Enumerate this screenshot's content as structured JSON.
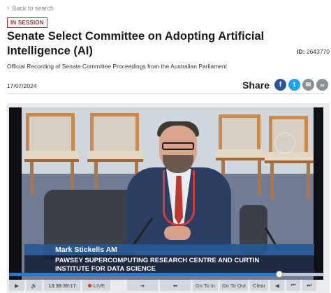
{
  "nav": {
    "back_label": "Back to search"
  },
  "status_badge": "IN SESSION",
  "title": "Senate Select Committee on Adopting Artificial Intelligence (AI)",
  "doc_id": {
    "label": "ID:",
    "value": "2643770"
  },
  "subtitle": "Official Recording of Senate Committee Proceedings from the Australian Parliament",
  "date": "17/07/2024",
  "share": {
    "label": "Share",
    "buttons": [
      {
        "icon": "facebook-icon",
        "glyph": "f",
        "color": "#2f5597"
      },
      {
        "icon": "twitter-icon",
        "glyph": "t",
        "color": "#1da1f2"
      },
      {
        "icon": "email-icon",
        "glyph": "✉",
        "color": "#8a8f95"
      },
      {
        "icon": "link-icon",
        "glyph": "∞",
        "color": "#8a8f95"
      }
    ]
  },
  "video": {
    "speaker_name": "Mark Stickells AM",
    "speaker_org_line1": "PAWSEY SUPERCOMPUTING RESEARCH CENTRE AND CURTIN",
    "speaker_org_line2": "INSTITUTE FOR DATA SCIENCE",
    "progress_fraction": 0.86
  },
  "controls": {
    "play_glyph": "▶",
    "volume_glyph": "🔊",
    "time": "13:38:39:17",
    "live_label": "LIVE",
    "forward_glyph": "➜",
    "back_glyph": "⬅",
    "goto_in": "Go To In",
    "goto_out": "Go To Out",
    "clear": "Clear",
    "prev_glyph": "◀",
    "skip_back_glyph": "⏮",
    "skip_fwd_glyph": "⏭"
  }
}
